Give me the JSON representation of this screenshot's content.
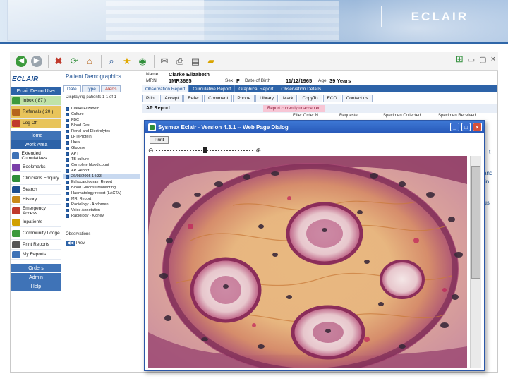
{
  "slide": {
    "logo_text": "ECLAIR"
  },
  "browser": {
    "toolbar_buttons": [
      "back-icon",
      "forward-icon",
      "stop-icon",
      "refresh-icon",
      "home-icon",
      "search-icon",
      "favorites-icon",
      "history-icon",
      "mail-icon",
      "print-icon",
      "edit-icon",
      "discuss-icon"
    ],
    "window_controls": [
      "×"
    ]
  },
  "app": {
    "brand": "ECLAIR",
    "nav": {
      "header_top": "Eclair Demo User",
      "items": [
        {
          "label": "Inbox ( 87 )",
          "style": "green"
        },
        {
          "label": "Referrals ( 20 )",
          "style": "hl"
        },
        {
          "label": "Log Off",
          "style": "hl"
        }
      ],
      "home_header": "Home",
      "work_area_header": "Work Area",
      "work_items": [
        "Extended Cumulatives",
        "Bookmarks",
        "Clinicians Enquiry",
        "Search",
        "History",
        "Emergency Access",
        "Inpatients",
        "Community Lodge",
        "Print Reports",
        "My Reports"
      ],
      "footer_headers": [
        "Orders",
        "Admin",
        "Help"
      ]
    },
    "patient_panel": {
      "title": "Patient Demographics",
      "tabs": [
        "Date",
        "Type",
        "Alerts"
      ],
      "search_label": "Displaying patients  1 1 of 1",
      "reports": [
        "Clarke Elizabeth",
        "Culture",
        "FBC",
        "Blood Gas",
        "Renal and Electrolytes",
        "LFT/Protein",
        "Urea",
        "Glucose",
        "APTT",
        "TB culture",
        "Complete blood count",
        "AP Report",
        "26/08/2005 14:33",
        "Echocardiogram Report",
        "Blood Glucose Monitoring",
        "Haematology report (LACTA)",
        "MRI Report",
        "Radiology - Abdomen",
        "Voice Annotation",
        "Radiology - Kidney"
      ],
      "selected_index": 12,
      "observations_label": "Observations",
      "page_nav": "Prev"
    },
    "demographics": {
      "name_label": "Name",
      "name_value": "Clarke Elizabeth",
      "mrn_label": "MRN",
      "mrn_value": "1MR3665",
      "sex_label": "Sex",
      "sex_value": "F",
      "dob_label": "Date of Birth",
      "dob_value": "11/12/1965",
      "age_label": "Age",
      "age_value": "39 Years"
    },
    "report_tabs": [
      "Observation Report",
      "Cumulative Report",
      "Graphical Report",
      "Observation Details"
    ],
    "report_tabs_active": 0,
    "actions": [
      "Print",
      "Accept",
      "Refer",
      "Comment",
      "Phone",
      "Library",
      "Mark",
      "CopyTo",
      "ECO",
      "Contact us"
    ],
    "report_title": "AP Report",
    "report_warning": "Report currently unaccepted",
    "report_columns": [
      "Filler Order N",
      "Requester",
      "Specimen Collected",
      "Specimen Received"
    ],
    "side_fragments": [
      "t",
      "and",
      "in",
      "ous"
    ]
  },
  "dialog": {
    "title": "Sysmex Eclair - Version 4.3.1 -- Web Page Dialog",
    "print_label": "Print",
    "controls": [
      "_",
      "□",
      "×"
    ]
  }
}
